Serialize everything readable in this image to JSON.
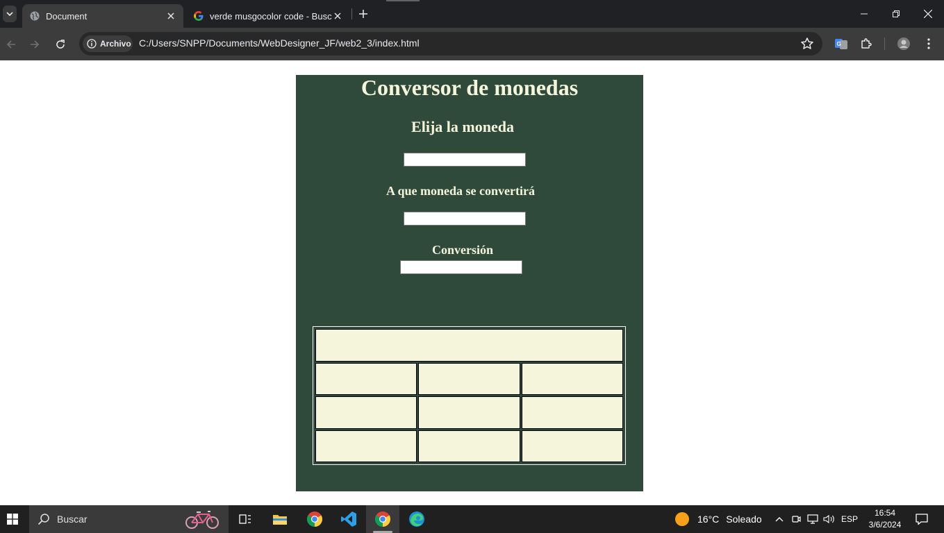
{
  "browser": {
    "tabs": [
      {
        "title": "Document",
        "active": true
      },
      {
        "title": "verde musgocolor code - Buscar",
        "active": false
      }
    ],
    "address": {
      "security_chip": "Archivo",
      "url": "C:/Users/SNPP/Documents/WebDesigner_JF/web2_3/index.html"
    }
  },
  "page": {
    "title": "Conversor de monedas",
    "from_label": "Elija la moneda",
    "to_label": "A que moneda se convertirá",
    "result_label": "Conversión",
    "from_value": "",
    "to_value": "",
    "result_value": "",
    "table": {
      "rows": [
        [
          ""
        ],
        [
          "",
          "",
          ""
        ],
        [
          "",
          "",
          ""
        ],
        [
          "",
          "",
          ""
        ]
      ]
    },
    "colors": {
      "panel_bg": "#2f4a3a",
      "heading_text": "#f5f5dc",
      "cell_bg": "#f5f5dc"
    }
  },
  "taskbar": {
    "search_placeholder": "Buscar",
    "weather": {
      "temp": "16°C",
      "condition": "Soleado"
    },
    "language": "ESP",
    "time": "16:54",
    "date": "3/6/2024",
    "apps": [
      "task-view",
      "file-explorer",
      "chrome",
      "vscode",
      "chrome-active",
      "edge"
    ]
  }
}
